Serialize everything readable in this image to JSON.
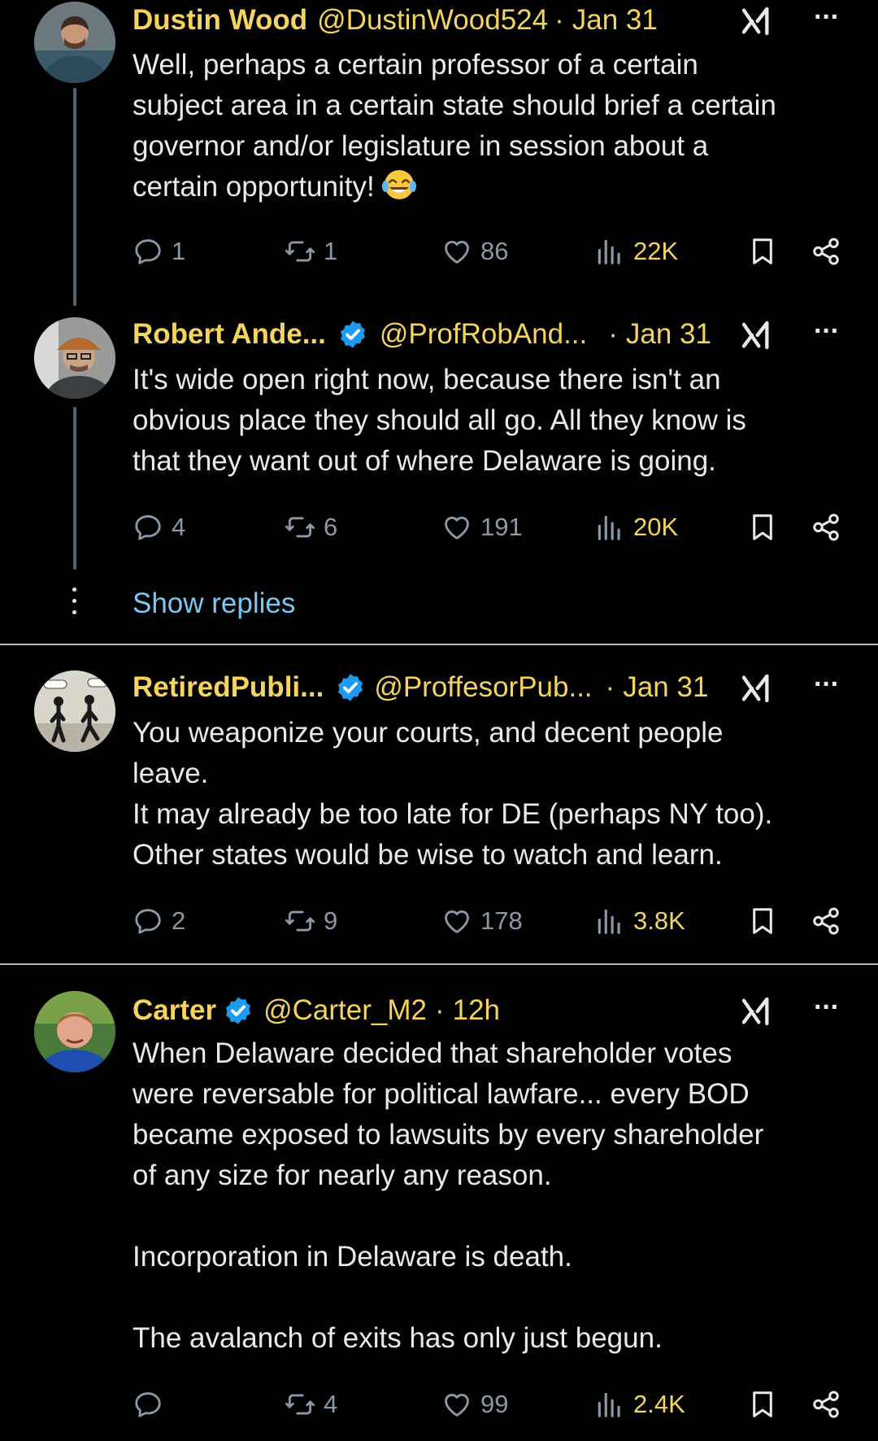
{
  "tweets": [
    {
      "name": "Dustin Wood",
      "handle": "@DustinWood524",
      "separator": "·",
      "date": "Jan 31",
      "verified": false,
      "body": "Well, perhaps a certain professor of a certain\nsubject area in a certain state should brief a certain\ngovernor and/or legislature in session about a\ncertain opportunity!",
      "emoji": "laughing-tears",
      "replies": "1",
      "reposts": "1",
      "likes": "86",
      "views": "22K"
    },
    {
      "name": "Robert Ande...",
      "handle": "@ProfRobAnd...",
      "separator": "·",
      "date": "Jan 31",
      "verified": true,
      "body": "It's wide open right now, because there isn't an\nobvious place they should all go. All they know is\nthat they want out of where Delaware is going.",
      "replies": "4",
      "reposts": "6",
      "likes": "191",
      "views": "20K"
    },
    {
      "name": "RetiredPubli...",
      "handle": "@ProffesorPub...",
      "separator": "·",
      "date": "Jan 31",
      "verified": true,
      "body": "You weaponize your courts, and decent people\nleave.\nIt may already be too late for DE (perhaps NY too).\nOther states would be wise to watch and learn.",
      "replies": "2",
      "reposts": "9",
      "likes": "178",
      "views": "3.8K"
    },
    {
      "name": "Carter",
      "handle": "@Carter_M2",
      "separator": "·",
      "date": "12h",
      "verified": true,
      "body": "When Delaware decided that shareholder votes\nwere reversable for political lawfare... every BOD\nbecame exposed to lawsuits by every shareholder\nof any size for nearly any reason.\n\nIncorporation in Delaware is death.\n\nThe avalanch of exits has only just begun.",
      "replies": "",
      "reposts": "4",
      "likes": "99",
      "views": "2.4K"
    }
  ],
  "show_replies": "Show replies",
  "more_label": "···",
  "colors": {
    "background": "#000000",
    "name_highlight": "#f4d35e",
    "text": "#e7e9ea",
    "muted": "#8b98a5",
    "link": "#7cc7f2",
    "verified": "#1d9bf0"
  },
  "icons": [
    "reply-icon",
    "repost-icon",
    "like-icon",
    "views-icon",
    "bookmark-icon",
    "share-icon",
    "verified-icon",
    "grok-icon",
    "more-icon"
  ]
}
